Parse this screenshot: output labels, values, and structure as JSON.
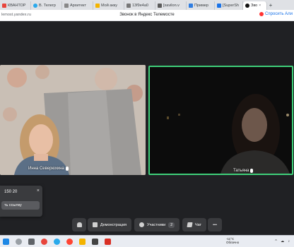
{
  "browser": {
    "tabs": [
      {
        "label": "КВАНТОР",
        "color": "#e8453c",
        "active": false
      },
      {
        "label": "В. Телегр",
        "color": "#29a9eb",
        "active": false
      },
      {
        "label": "Архитект",
        "color": "#888888",
        "active": false
      },
      {
        "label": "Мой акку",
        "color": "#f4b400",
        "active": false
      },
      {
        "label": "13f9e4a0",
        "color": "#777777",
        "active": false
      },
      {
        "label": "[xavilon.v",
        "color": "#5b5b5b",
        "active": false
      },
      {
        "label": "Пример",
        "color": "#2f7de1",
        "active": false
      },
      {
        "label": "[SuperSh",
        "color": "#1a73e8",
        "active": false
      },
      {
        "label": "Зво",
        "color": "#111111",
        "active": true
      }
    ],
    "url": "lemost.yandex.ru",
    "page_title": "Звонок в Яндекс Телемосте",
    "ask_alice": "Спросить Али"
  },
  "call": {
    "participant1_name": "Инна Северюхина",
    "participant2_name": "Татьяна",
    "toast_code": "150 20",
    "toast_close": "×",
    "toast_button": "ть ссылку"
  },
  "toolbar": {
    "demo_label": "Демонстрация",
    "participants_label": "Участники",
    "participants_count": "2",
    "chat_label": "Чат",
    "more_label": "•••"
  },
  "taskbar": {
    "weather_temp": "-11°C",
    "weather_desc": "Облачно",
    "tray": "^ ☁ ♪"
  },
  "colors": {
    "active_speaker": "#3fd07a",
    "accent": "#1a73e8"
  }
}
